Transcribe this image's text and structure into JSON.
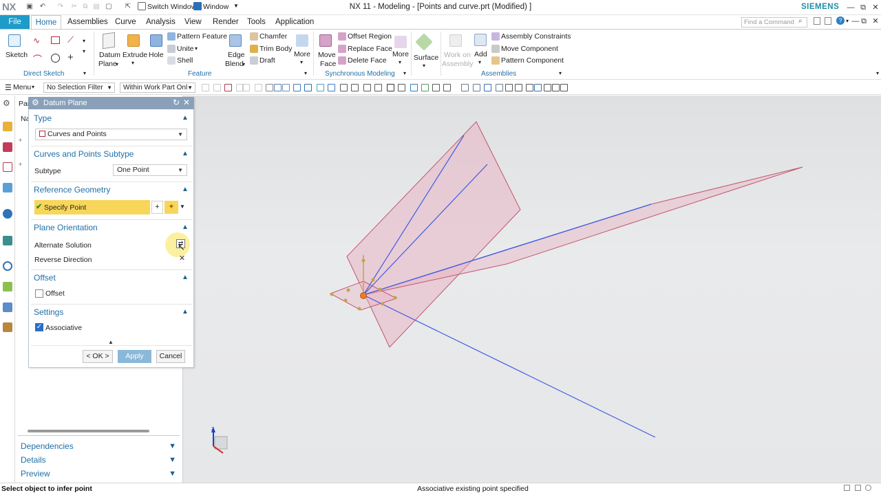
{
  "app": {
    "logo": "NX",
    "title": "NX 11 - Modeling - [Points and curve.prt (Modified) ]",
    "brand": "SIEMENS",
    "switch_window": "Switch Window",
    "window_menu": "Window"
  },
  "colors": {
    "accent": "#1d9bc9",
    "dialog_title": "#8aa0b9",
    "section_text": "#1f6fa7",
    "highlight": "#f7d65a",
    "plane_fill": "#e8b4c4",
    "plane_edge": "#c0566c",
    "line_blue": "#3f5be0"
  },
  "menu": {
    "file": "File",
    "tabs": [
      "Home",
      "Assemblies",
      "Curve",
      "Analysis",
      "View",
      "Render",
      "Tools",
      "Application"
    ],
    "find_placeholder": "Find a Command"
  },
  "ribbon": {
    "direct_sketch": {
      "label": "Direct Sketch",
      "sketch": "Sketch"
    },
    "feature": {
      "label": "Feature",
      "datum_plane": "Datum",
      "datum_plane2": "Plane",
      "extrude": "Extrude",
      "hole": "Hole",
      "pattern_feature": "Pattern Feature",
      "unite": "Unite",
      "shell": "Shell",
      "edge_blend": "Edge",
      "edge_blend2": "Blend",
      "chamfer": "Chamfer",
      "trim_body": "Trim Body",
      "draft": "Draft",
      "more": "More"
    },
    "sync": {
      "label": "Synchronous Modeling",
      "move_face": "Move",
      "move_face2": "Face",
      "offset_region": "Offset Region",
      "replace_face": "Replace Face",
      "delete_face": "Delete Face",
      "more": "More",
      "surface": "Surface"
    },
    "assemblies": {
      "label": "Assemblies",
      "work_on": "Work on",
      "work_on2": "Assembly",
      "add": "Add",
      "constraints": "Assembly Constraints",
      "move_component": "Move Component",
      "pattern_component": "Pattern Component"
    }
  },
  "toolbar": {
    "menu": "Menu",
    "selection_filter": "No Selection Filter",
    "scope": "Within Work Part Onl"
  },
  "navigator": {
    "tab_partial": "Par",
    "col_partial": "Na",
    "dependencies": "Dependencies",
    "details": "Details",
    "preview": "Preview"
  },
  "dialog": {
    "title": "Datum Plane",
    "type_section": "Type",
    "type_value": "Curves and Points",
    "subtype_section": "Curves and Points Subtype",
    "subtype_label": "Subtype",
    "subtype_value": "One Point",
    "ref_section": "Reference Geometry",
    "specify_point": "Specify Point",
    "orientation_section": "Plane Orientation",
    "alternate_solution": "Alternate Solution",
    "reverse_direction": "Reverse Direction",
    "offset_section": "Offset",
    "offset_label": "Offset",
    "offset_checked": false,
    "settings_section": "Settings",
    "associative_label": "Associative",
    "associative_checked": true,
    "ok": "< OK >",
    "apply": "Apply",
    "cancel": "Cancel"
  },
  "status": {
    "left": "Select object to infer point",
    "center": "Associative existing point specified"
  }
}
